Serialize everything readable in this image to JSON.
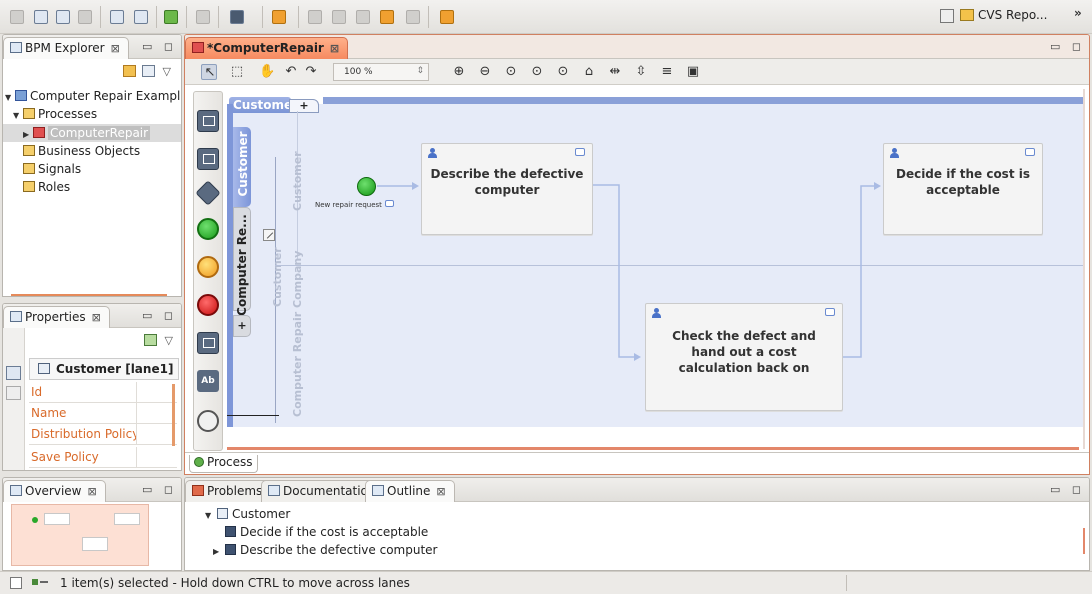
{
  "toolbar": {
    "perspective_label": "CVS Repo...",
    "more_label": "»"
  },
  "explorer": {
    "tab_label": "BPM Explorer",
    "close_glyph": "⊠",
    "minmax_glyph": "▭ ◻",
    "tree": [
      {
        "label": "Computer Repair Example",
        "arrow": "▼"
      },
      {
        "label": "Processes",
        "arrow": "▼"
      },
      {
        "label": "ComputerRepair",
        "arrow": "▶"
      },
      {
        "label": "Business Objects",
        "arrow": ""
      },
      {
        "label": "Signals",
        "arrow": ""
      },
      {
        "label": "Roles",
        "arrow": ""
      }
    ]
  },
  "properties": {
    "tab_label": "Properties",
    "close_glyph": "⊠",
    "minmax_glyph": "▭ ◻",
    "header": "Customer [lane1]",
    "rows": [
      "Id",
      "Name",
      "Distribution Policy",
      "Save Policy"
    ]
  },
  "overview": {
    "tab_label": "Overview",
    "close_glyph": "⊠",
    "minmax_glyph": "▭ ◻"
  },
  "editor": {
    "tab_label": "*ComputerRepair",
    "close_glyph": "⊠",
    "minmax_glyph": "▭ ◻",
    "zoom_value": "100 %",
    "zoom_spin": "⇕",
    "bottom_tab": "Process",
    "pool": {
      "tab_label": "Customer",
      "plus": "+",
      "vtab_label": "Customer",
      "lane_tab_label": "Computer Re...",
      "lane_plus": "+",
      "labels": {
        "inner_customer_top": "Customer",
        "inner_customer_mid": "Customer",
        "computer_repair_company": "Computer Repair Company"
      }
    },
    "start_event_label": "New repair request",
    "tasks": [
      {
        "label": "Describe the defective computer"
      },
      {
        "label": "Decide if the cost is acceptable"
      },
      {
        "label": "Check the defect and hand out a cost calculation back on"
      }
    ]
  },
  "bottom_panel": {
    "tabs": [
      {
        "label": "Problems"
      },
      {
        "label": "Documentation"
      },
      {
        "label": "Outline",
        "close_glyph": "⊠"
      }
    ],
    "minmax_glyph": "▭ ◻",
    "outline": [
      {
        "label": "Customer",
        "arrow": "▼"
      },
      {
        "label": "Decide if the cost is acceptable",
        "arrow": ""
      },
      {
        "label": "Describe the defective computer",
        "arrow": "▶"
      }
    ]
  },
  "status": {
    "text": "1 item(s) selected - Hold down CTRL to move across lanes"
  }
}
